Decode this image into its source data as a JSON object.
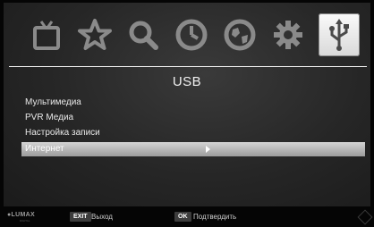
{
  "icons": {
    "items": [
      {
        "name": "tv-icon",
        "selected": false
      },
      {
        "name": "star-icon",
        "selected": false
      },
      {
        "name": "search-icon",
        "selected": false
      },
      {
        "name": "clock-icon",
        "selected": false
      },
      {
        "name": "globe-icon",
        "selected": false
      },
      {
        "name": "gear-icon",
        "selected": false
      },
      {
        "name": "usb-icon",
        "selected": true
      }
    ]
  },
  "page": {
    "title": "USB"
  },
  "menu": {
    "items": [
      {
        "label": "Мультимедиа"
      },
      {
        "label": "PVR Медиа"
      },
      {
        "label": "Настройка записи"
      },
      {
        "label": "Интернет",
        "selected": true
      }
    ]
  },
  "footer": {
    "brand": "●LUMAX",
    "brand_sub": "DIGITAL",
    "exit_key": "EXIT",
    "exit_label": "Выход",
    "ok_key": "OK",
    "ok_label": "Подтвердить"
  },
  "colors": {
    "icon_inactive": "#8a8a8a",
    "selected_bar": "#b8b8b8",
    "text": "#e8e8e8"
  }
}
